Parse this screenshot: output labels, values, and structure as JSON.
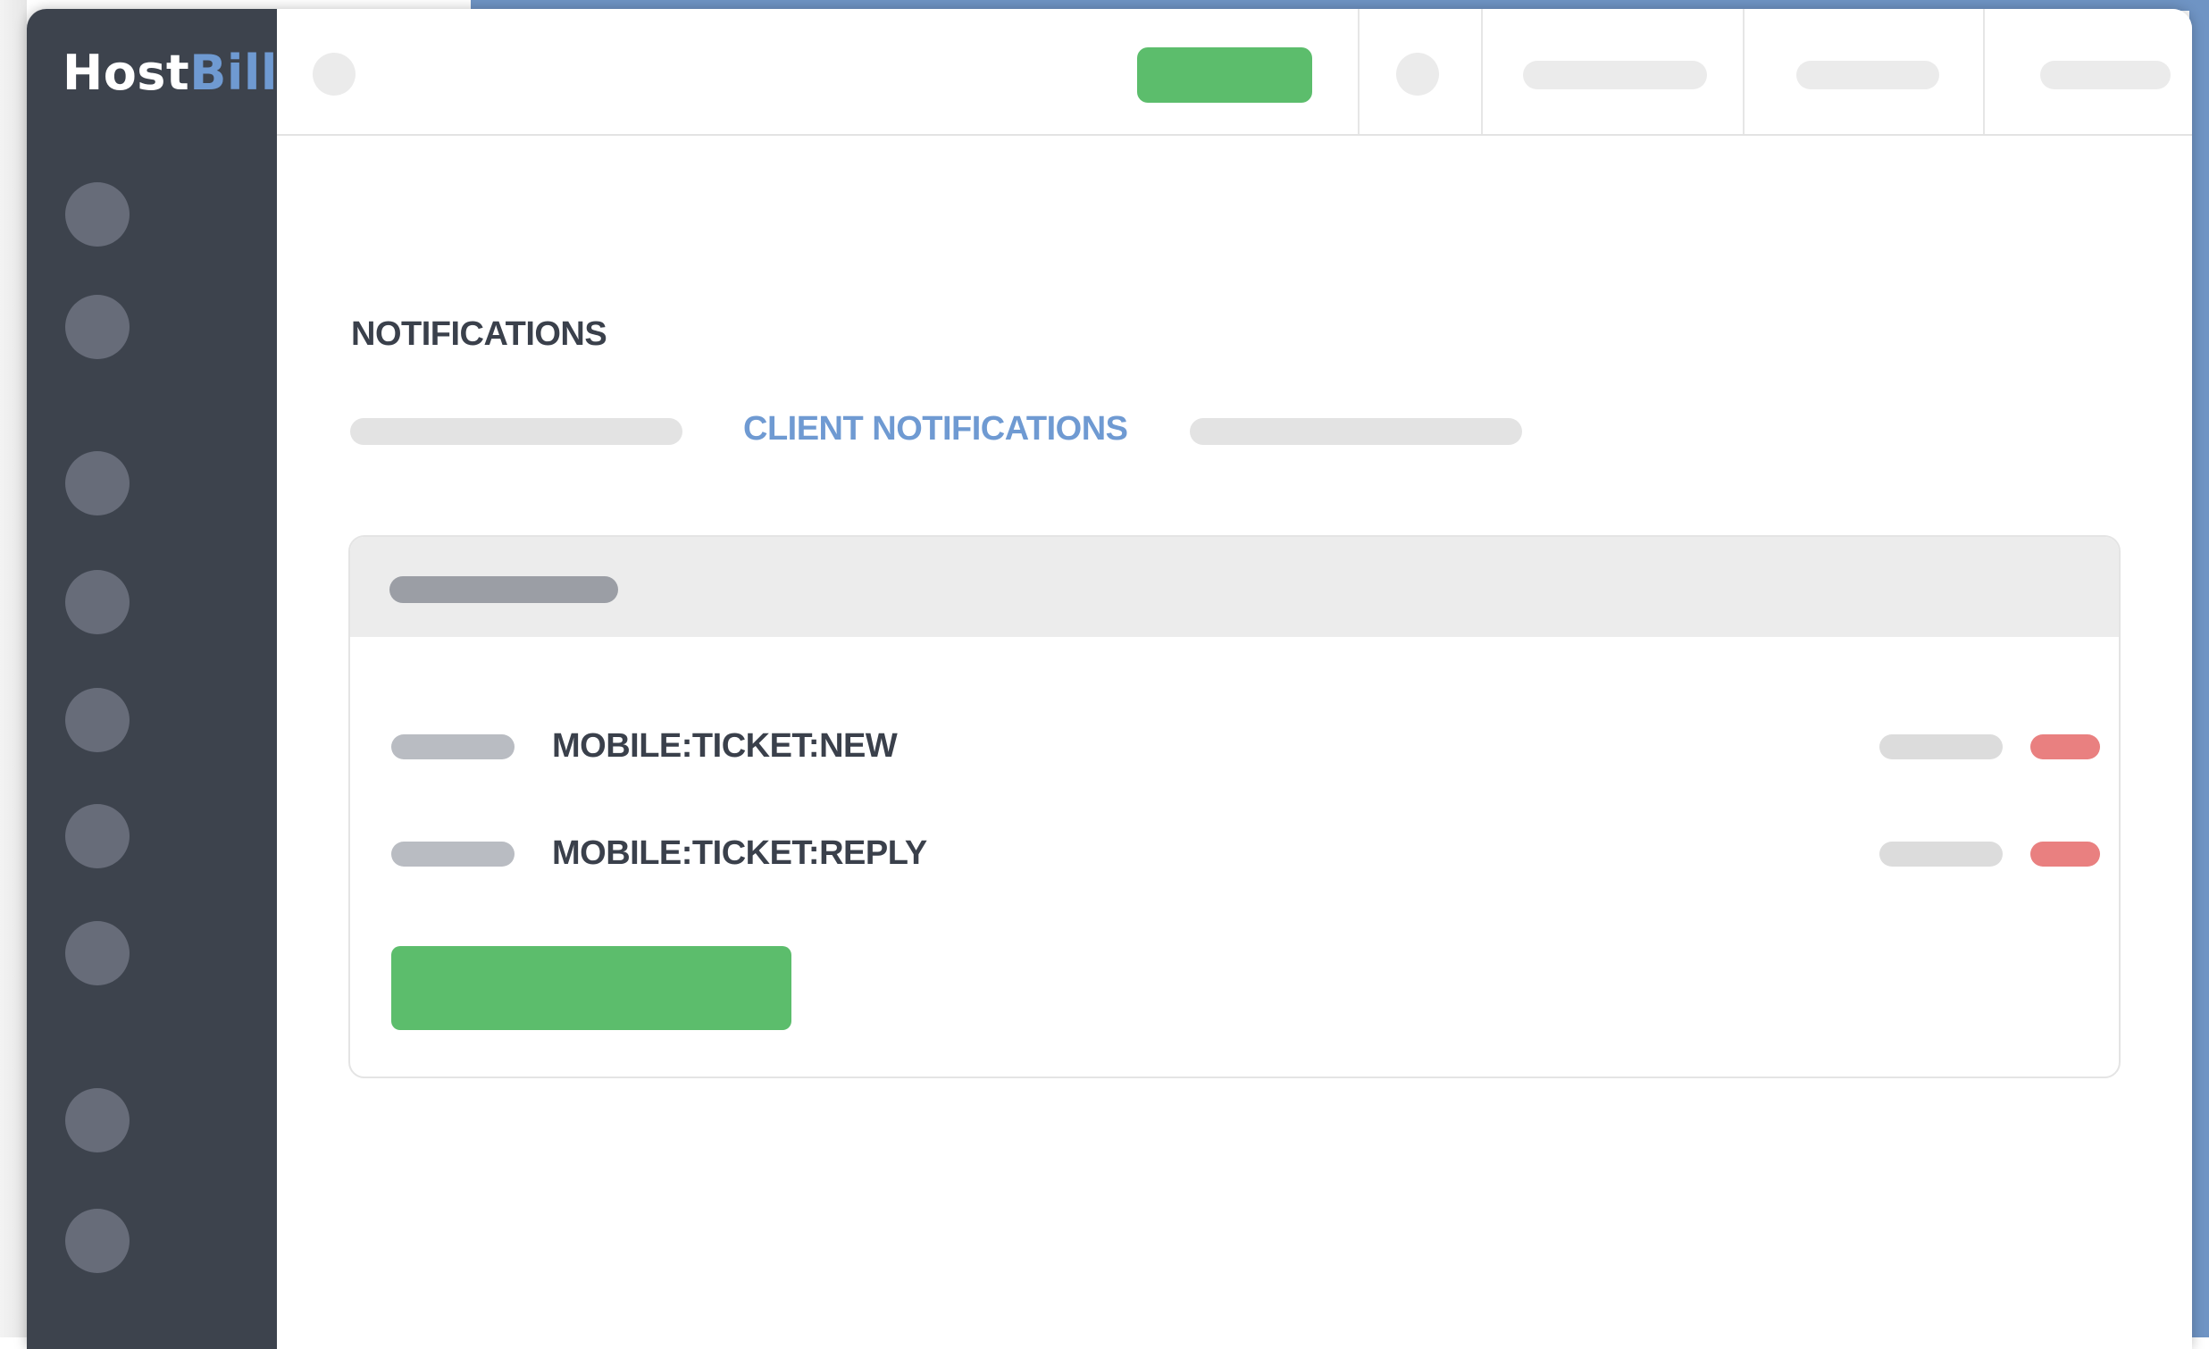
{
  "colors": {
    "accent_blue": "#6f9ad2",
    "green": "#5cbd6c",
    "red": "#e98080",
    "sidebar_bg": "#3d434d",
    "frame_blue": "#6f94c4"
  },
  "brand": {
    "logo_host": "Host",
    "logo_bill": "Bill"
  },
  "sidebar": {
    "items": [
      {
        "icon": "sidebar-nav-icon"
      },
      {
        "icon": "sidebar-nav-icon"
      },
      {
        "icon": "sidebar-nav-icon"
      },
      {
        "icon": "sidebar-nav-icon"
      },
      {
        "icon": "sidebar-nav-icon"
      },
      {
        "icon": "sidebar-nav-icon"
      },
      {
        "icon": "sidebar-nav-icon"
      },
      {
        "icon": "sidebar-nav-icon"
      },
      {
        "icon": "sidebar-nav-icon"
      }
    ]
  },
  "page": {
    "title": "NOTIFICATIONS",
    "active_tab": "CLIENT NOTIFICATIONS"
  },
  "notifications": {
    "rows": [
      {
        "label": "MOBILE:TICKET:NEW"
      },
      {
        "label": "MOBILE:TICKET:REPLY"
      }
    ]
  }
}
